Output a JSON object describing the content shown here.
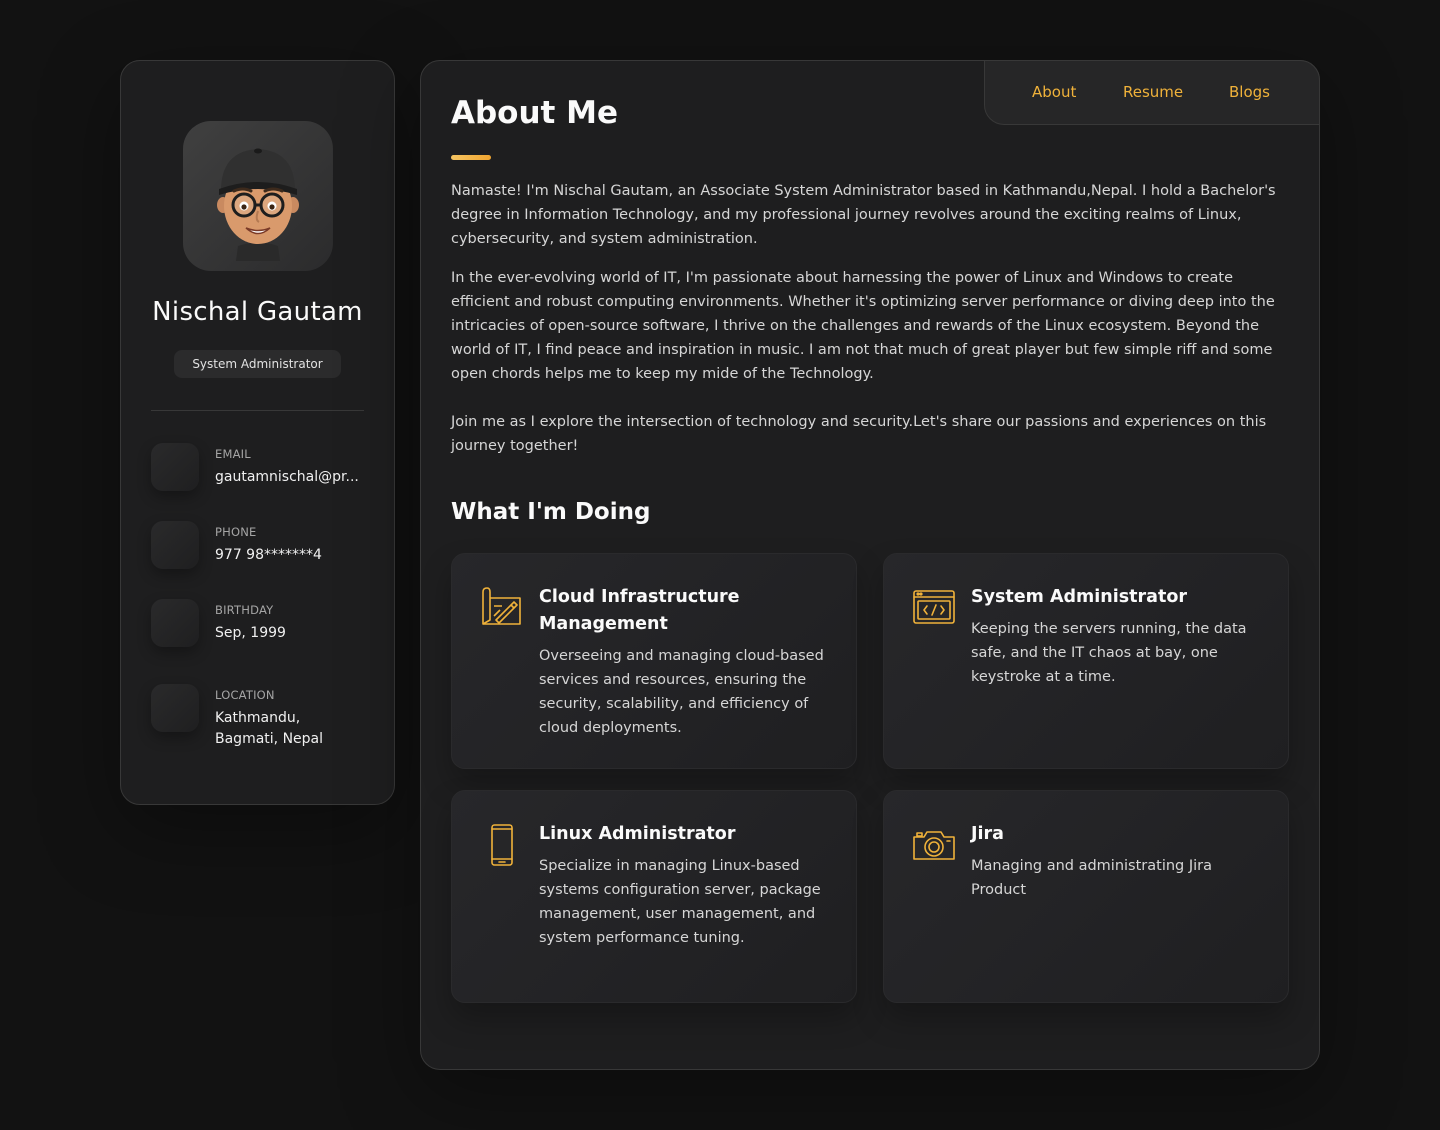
{
  "sidebar": {
    "name": "Nischal Gautam",
    "title": "System Administrator",
    "contacts": [
      {
        "label": "EMAIL",
        "value": "gautamnischal@pr..."
      },
      {
        "label": "PHONE",
        "value": "977 98*******4"
      },
      {
        "label": "BIRTHDAY",
        "value": "Sep, 1999"
      },
      {
        "label": "LOCATION",
        "value": "Kathmandu, Bagmati, Nepal"
      }
    ]
  },
  "nav": {
    "items": [
      "About",
      "Resume",
      "Blogs"
    ]
  },
  "about": {
    "title": "About Me",
    "paragraphs": [
      "Namaste! I'm Nischal Gautam, an Associate System Administrator based in Kathmandu,Nepal. I hold a Bachelor's degree in Information Technology, and my professional journey revolves around the exciting realms of Linux, cybersecurity, and system administration.",
      "In the ever-evolving world of IT, I'm passionate about harnessing the power of Linux and Windows to create efficient and robust computing environments. Whether it's optimizing server performance or diving deep into the intricacies of open-source software, I thrive on the challenges and rewards of the Linux ecosystem. Beyond the world of IT, I find peace and inspiration in music. I am not that much of great player but few simple riff and some open chords helps me to keep my mide of the Technology.",
      "Join me as I explore the intersection of technology and security.Let's share our passions and experiences on this journey together!"
    ]
  },
  "services": {
    "title": "What I'm Doing",
    "items": [
      {
        "title": "Cloud Infrastructure Management",
        "description": "Overseeing and managing cloud-based services and resources, ensuring the security, scalability, and efficiency of cloud deployments.",
        "icon": "design-drawing-icon"
      },
      {
        "title": "System Administrator",
        "description": "Keeping the servers running, the data safe, and the IT chaos at bay, one keystroke at a time.",
        "icon": "code-window-icon"
      },
      {
        "title": "Linux Administrator",
        "description": "Specialize in managing Linux-based systems configuration server, package management, user management, and system performance tuning.",
        "icon": "mobile-phone-icon"
      },
      {
        "title": "Jira",
        "description": "Managing and administrating Jira Product",
        "icon": "camera-icon"
      }
    ]
  },
  "colors": {
    "accent": "#f0b23a",
    "background": "#121212",
    "panel": "#1e1e1f"
  }
}
